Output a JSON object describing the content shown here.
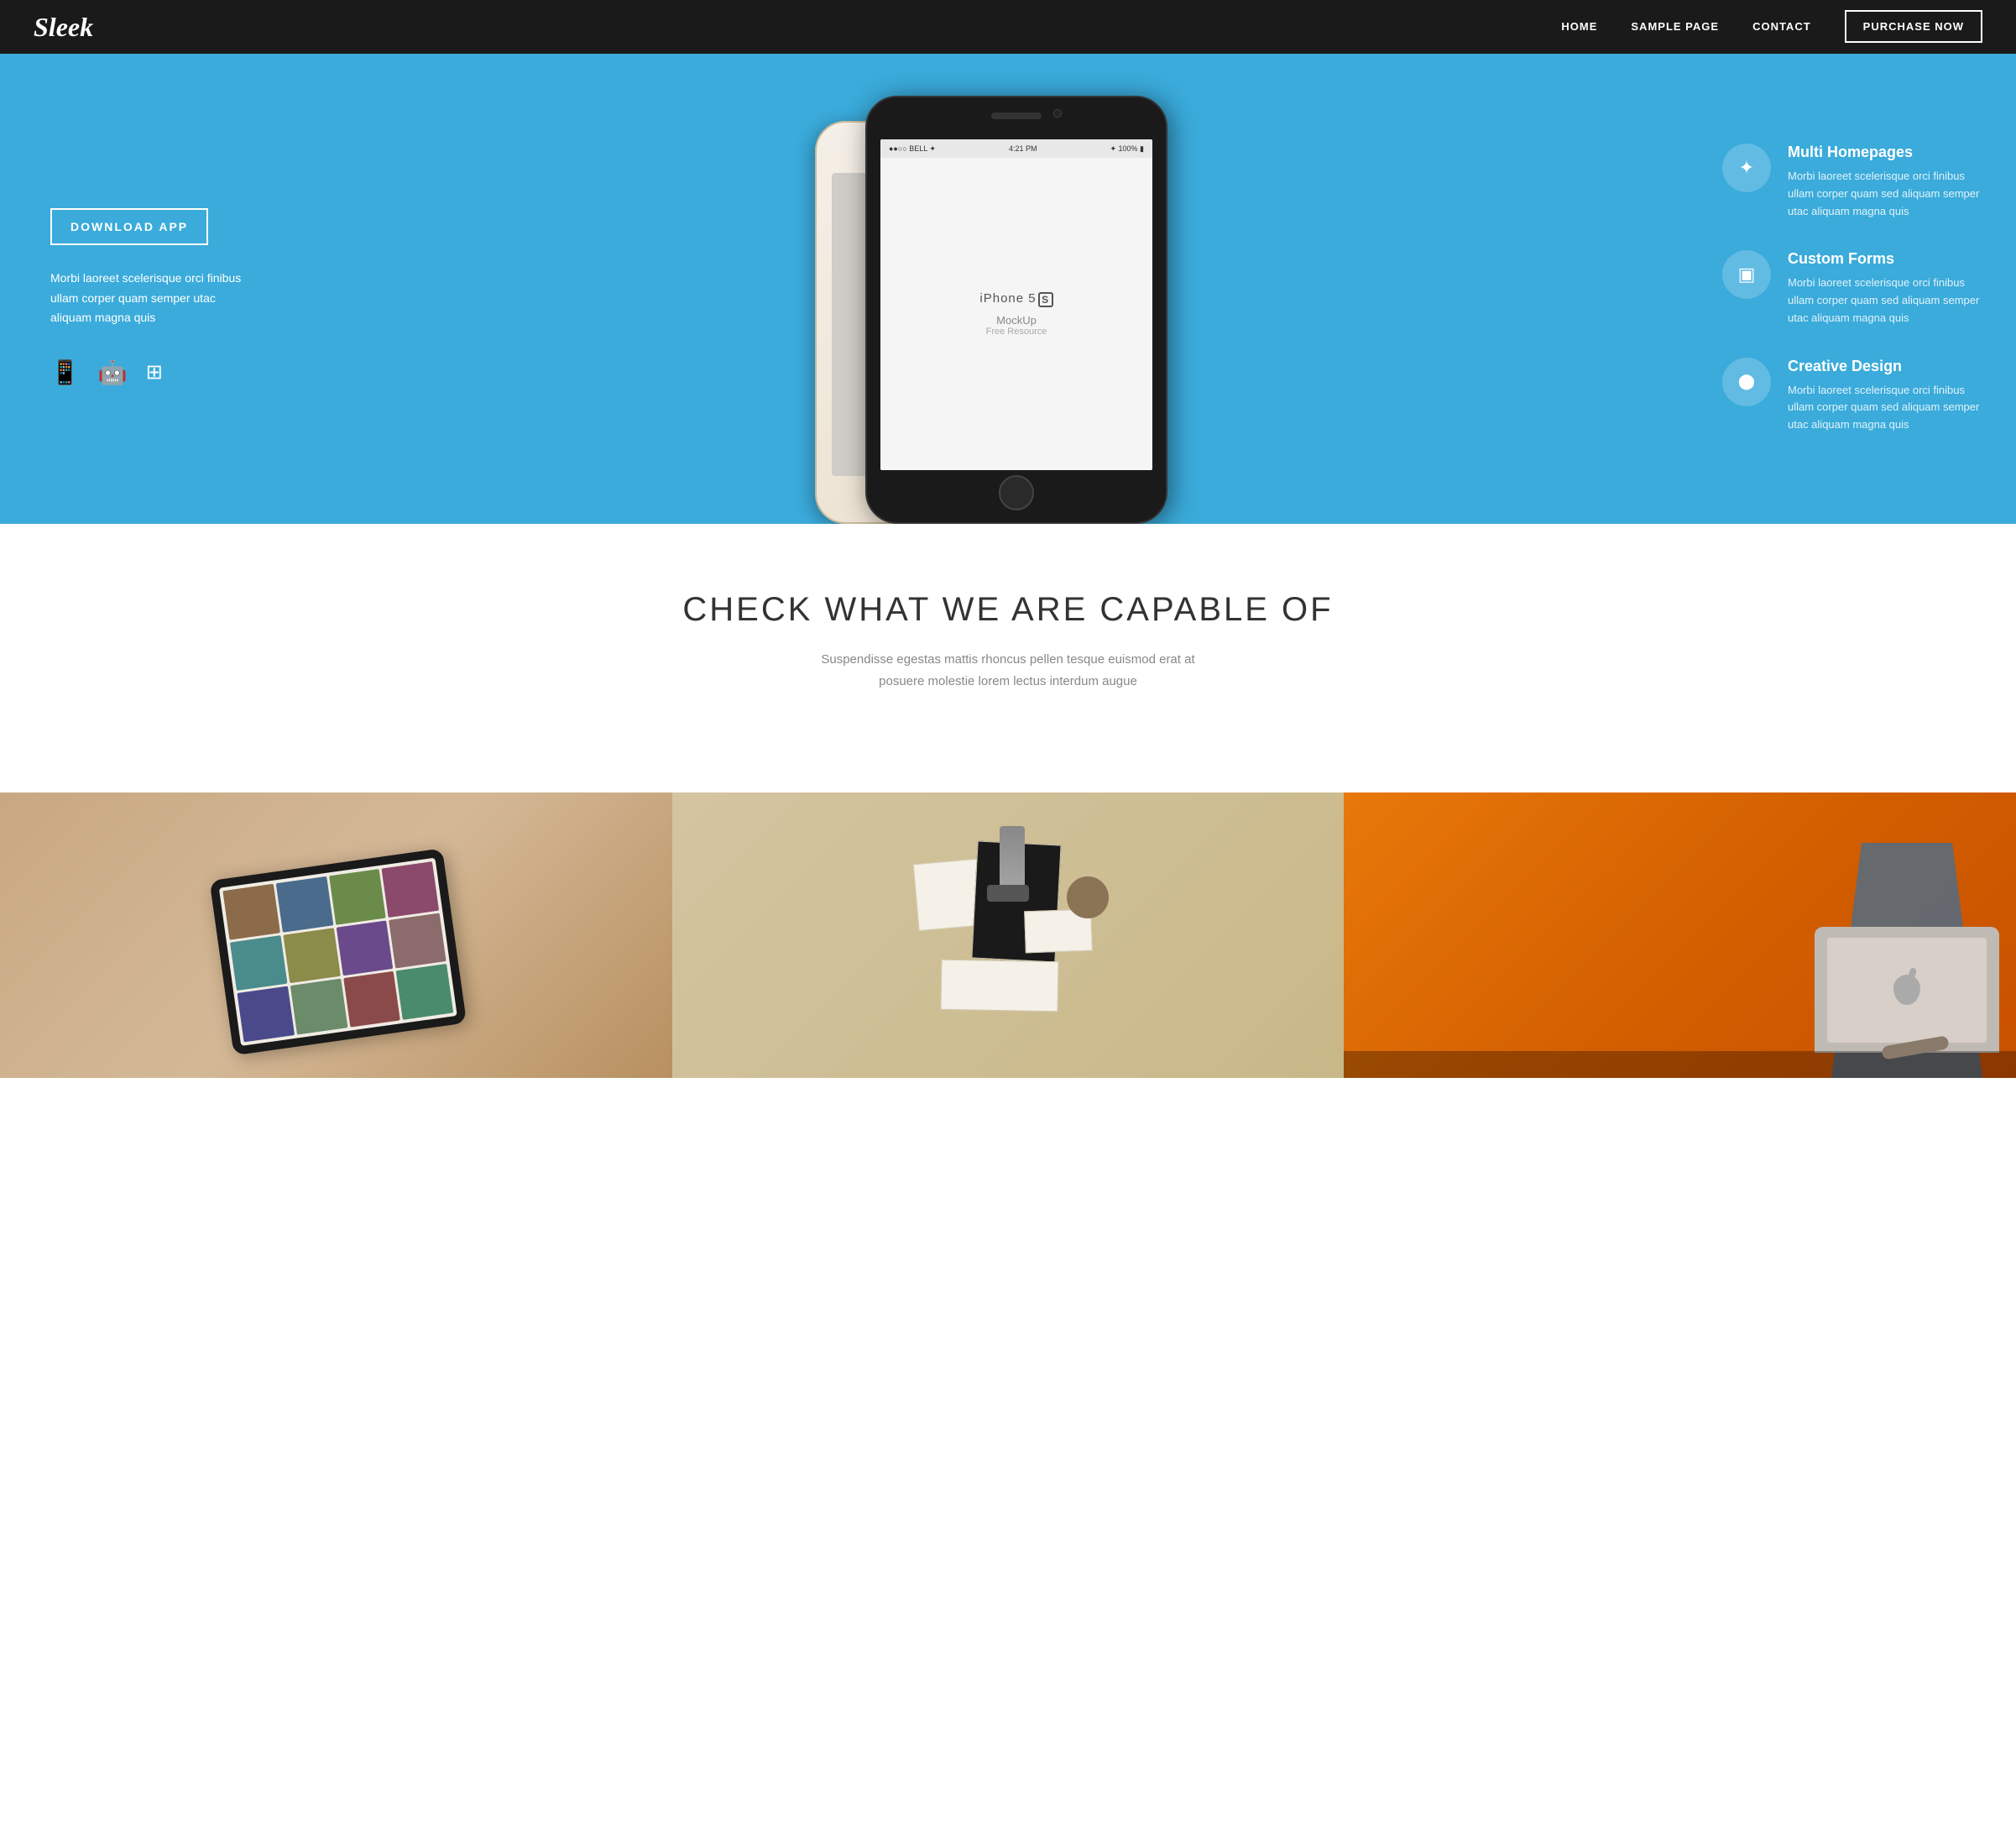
{
  "nav": {
    "logo": "Sleek",
    "links": [
      {
        "label": "HOME",
        "href": "#"
      },
      {
        "label": "SAMPLE PAGE",
        "href": "#"
      },
      {
        "label": "CONTACT",
        "href": "#"
      }
    ],
    "purchase_label": "PURCHASE NOW"
  },
  "hero": {
    "download_btn": "DOWNLOAD APP",
    "description": "Morbi laoreet scelerisque orci finibus ullam corper quam semper utac aliquam magna quis",
    "platforms": [
      "📱",
      "🤖",
      "⊞"
    ],
    "phone_screen": {
      "status_left": "●●○○ BELL ✦",
      "status_time": "4:21 PM",
      "status_right": "✦ 100%",
      "iphone_text": "iPhone 5",
      "model_badge": "S",
      "mockup_label": "MockUp",
      "free_resource": "Free Resource"
    },
    "features": [
      {
        "icon": "✦",
        "title": "Multi Homepages",
        "description": "Morbi laoreet scelerisque orci finibus ullam corper quam sed aliquam semper utac aliquam magna quis"
      },
      {
        "icon": "▣",
        "title": "Custom Forms",
        "description": "Morbi laoreet scelerisque orci finibus ullam corper quam sed aliquam semper utac aliquam magna quis"
      },
      {
        "icon": "⬤",
        "title": "Creative Design",
        "description": "Morbi laoreet scelerisque orci finibus ullam corper quam sed aliquam semper utac aliquam magna quis"
      }
    ]
  },
  "capabilities": {
    "heading": "CHECK WHAT WE ARE CAPABLE OF",
    "subtext_line1": "Suspendisse egestas mattis rhoncus pellen tesque euismod erat at",
    "subtext_line2": "posuere molestie lorem lectus interdum augue"
  },
  "cards": [
    {
      "type": "tablet",
      "alt": "Tablet with media grid"
    },
    {
      "type": "stationery",
      "alt": "Stationery items"
    },
    {
      "type": "workspace",
      "alt": "Person working on laptop"
    }
  ],
  "colors": {
    "hero_bg": "#3aabdb",
    "nav_bg": "#1a1a1a",
    "purchase_border": "#ffffff",
    "accent_orange": "#e8780a"
  }
}
